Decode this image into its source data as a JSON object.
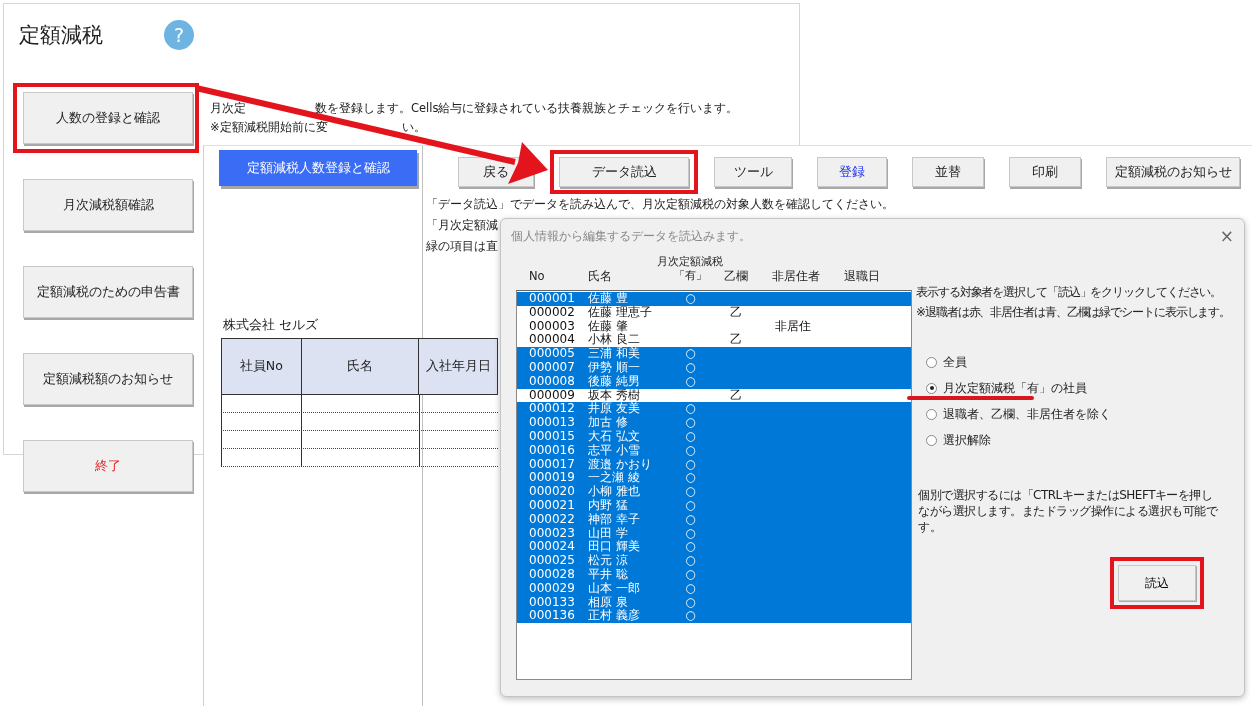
{
  "app": {
    "title": "定額減税",
    "help": "?"
  },
  "sidebar": {
    "buttons": [
      {
        "label": "人数の登録と確認",
        "highlighted": true,
        "kind": "normal"
      },
      {
        "label": "月次減税額確認",
        "highlighted": false,
        "kind": "normal"
      },
      {
        "label": "定額減税のための申告書",
        "highlighted": false,
        "kind": "normal"
      },
      {
        "label": "定額減税額のお知らせ",
        "highlighted": false,
        "kind": "normal"
      },
      {
        "label": "終了",
        "highlighted": false,
        "kind": "exit"
      }
    ]
  },
  "description": [
    {
      "parts": [
        "月次定",
        "数を登録します。Cells給与に登録されている扶養親族とチェックを行います。"
      ]
    },
    {
      "parts": [
        "※定額減税開始前に変",
        "い。"
      ]
    }
  ],
  "sheet": {
    "title_button": "定額減税人数登録と確認",
    "toolbar": [
      {
        "label": "戻る",
        "highlighted": false,
        "kind": "normal"
      },
      {
        "label": "データ読込",
        "highlighted": true,
        "kind": "normal"
      },
      {
        "label": "ツール",
        "highlighted": false,
        "kind": "normal"
      },
      {
        "label": "登録",
        "highlighted": false,
        "kind": "accent"
      },
      {
        "label": "並替",
        "highlighted": false,
        "kind": "normal"
      },
      {
        "label": "印刷",
        "highlighted": false,
        "kind": "normal"
      },
      {
        "label": "定額減税のお知らせ",
        "highlighted": false,
        "kind": "normal"
      }
    ],
    "notes": [
      "「データ読込」でデータを読み込んで、月次定額減税の対象人数を確認してください。",
      "「月次定額減",
      "緑の項目は直"
    ],
    "company": "株式会社  セルズ",
    "table": {
      "columns": [
        "社員No",
        "氏名",
        "入社年月日"
      ]
    }
  },
  "dialog": {
    "title": "個人情報から編集するデータを読込みます。",
    "close": "×",
    "columns": [
      {
        "label": "No"
      },
      {
        "label": "氏名"
      },
      {
        "label": "月次定額減税",
        "sub": "「有」"
      },
      {
        "label": "乙欄"
      },
      {
        "label": "非居住者"
      },
      {
        "label": "退職日"
      }
    ],
    "rows": [
      {
        "no": "000001",
        "name": "佐藤 豊",
        "flag": "○",
        "selected": true
      },
      {
        "no": "000002",
        "name": "佐藤 理恵子",
        "otsu": "乙",
        "selected": false
      },
      {
        "no": "000003",
        "name": "佐藤 肇",
        "nonresident": "非居住",
        "selected": false
      },
      {
        "no": "000004",
        "name": "小林 良二",
        "otsu": "乙",
        "selected": false
      },
      {
        "no": "000005",
        "name": "三浦  和美",
        "flag": "○",
        "selected": true
      },
      {
        "no": "000007",
        "name": "伊勢  順一",
        "flag": "○",
        "selected": true
      },
      {
        "no": "000008",
        "name": "後藤 純男",
        "flag": "○",
        "selected": true
      },
      {
        "no": "000009",
        "name": "坂本 秀樹",
        "otsu": "乙",
        "selected": false
      },
      {
        "no": "000012",
        "name": "井原 友美",
        "flag": "○",
        "selected": true
      },
      {
        "no": "000013",
        "name": "加古 修",
        "flag": "○",
        "selected": true
      },
      {
        "no": "000015",
        "name": "大石 弘文",
        "flag": "○",
        "selected": true
      },
      {
        "no": "000016",
        "name": "志平 小雪",
        "flag": "○",
        "selected": true
      },
      {
        "no": "000017",
        "name": "渡邉 かおり",
        "flag": "○",
        "selected": true
      },
      {
        "no": "000019",
        "name": "一之瀬 綾",
        "flag": "○",
        "selected": true
      },
      {
        "no": "000020",
        "name": "小柳 雅也",
        "flag": "○",
        "selected": true
      },
      {
        "no": "000021",
        "name": "内野 猛",
        "flag": "○",
        "selected": true
      },
      {
        "no": "000022",
        "name": "神部 幸子",
        "flag": "○",
        "selected": true
      },
      {
        "no": "000023",
        "name": "山田 学",
        "flag": "○",
        "selected": true
      },
      {
        "no": "000024",
        "name": "田口 輝美",
        "flag": "○",
        "selected": true
      },
      {
        "no": "000025",
        "name": "松元 涼",
        "flag": "○",
        "selected": true
      },
      {
        "no": "000028",
        "name": "平井 聡",
        "flag": "○",
        "selected": true
      },
      {
        "no": "000029",
        "name": "山本 一郎",
        "flag": "○",
        "selected": true
      },
      {
        "no": "000133",
        "name": "相原  泉",
        "flag": "○",
        "selected": true
      },
      {
        "no": "000136",
        "name": "正村  義彦",
        "flag": "○",
        "selected": true
      }
    ],
    "instructions": [
      "表示する対象者を選択して「読込」をクリックしてください。",
      "※退職者は赤、非居住者は青、乙欄は緑でシートに表示します。"
    ],
    "options": [
      {
        "label": "全員",
        "selected": false,
        "underlined": false
      },
      {
        "label": "月次定額減税「有」の社員",
        "selected": true,
        "underlined": true
      },
      {
        "label": "退職者、乙欄、非居住者を除く",
        "selected": false,
        "underlined": false
      },
      {
        "label": "選択解除",
        "selected": false,
        "underlined": false
      }
    ],
    "note": "個別で選択するには「CTRLキーまたはSHEFTキーを押しながら選択します。またドラッグ操作による選択も可能です。",
    "button": {
      "label": "読込",
      "highlighted": true
    }
  }
}
